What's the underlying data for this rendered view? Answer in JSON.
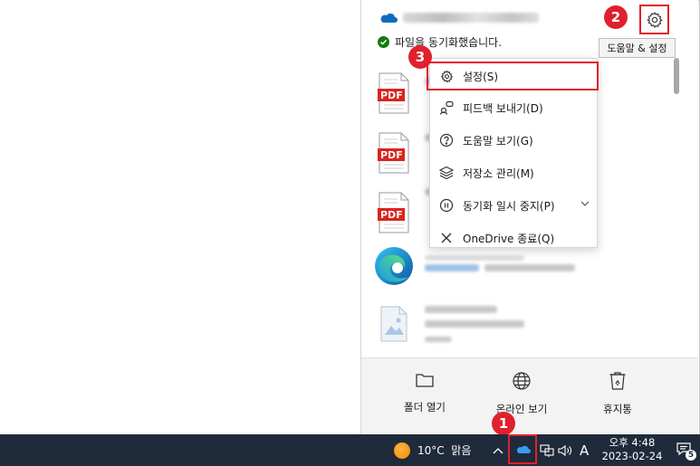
{
  "onedrive_flyout": {
    "status_text": "파일을 동기화했습니다.",
    "tooltip": "도움말 & 설정",
    "icons": {
      "logo": "onedrive-cloud-icon",
      "status": "check-icon",
      "settings": "gear-icon"
    },
    "files": [
      {
        "type": "pdf",
        "icon_label": "PDF"
      },
      {
        "type": "pdf",
        "icon_label": "PDF"
      },
      {
        "type": "pdf",
        "icon_label": "PDF"
      },
      {
        "type": "edge"
      },
      {
        "type": "image"
      }
    ],
    "menu": [
      {
        "label": "설정(S)",
        "icon": "gear-icon"
      },
      {
        "label": "피드백 보내기(D)",
        "icon": "feedback-icon"
      },
      {
        "label": "도움말 보기(G)",
        "icon": "help-icon"
      },
      {
        "label": "저장소 관리(M)",
        "icon": "storage-layers-icon"
      },
      {
        "label": "동기화 일시 중지(P)",
        "icon": "pause-icon",
        "has_submenu": true
      },
      {
        "label": "OneDrive 종료(Q)",
        "icon": "close-icon"
      }
    ],
    "footer": [
      {
        "label": "폴더 열기",
        "icon": "folder-icon"
      },
      {
        "label": "온라인 보기",
        "icon": "globe-icon"
      },
      {
        "label": "휴지통",
        "icon": "recycle-bin-icon"
      }
    ]
  },
  "taskbar": {
    "weather": "10°C  맑음",
    "ime": "A",
    "time": "오후 4:48",
    "date": "2023-02-24",
    "notification_count": "5"
  },
  "callouts": [
    "1",
    "2",
    "3"
  ],
  "colors": {
    "callout_red": "#e0202c",
    "onedrive_blue": "#0f6cbd",
    "taskbar": "#1f2a3a",
    "sync_ok": "#107c10"
  }
}
